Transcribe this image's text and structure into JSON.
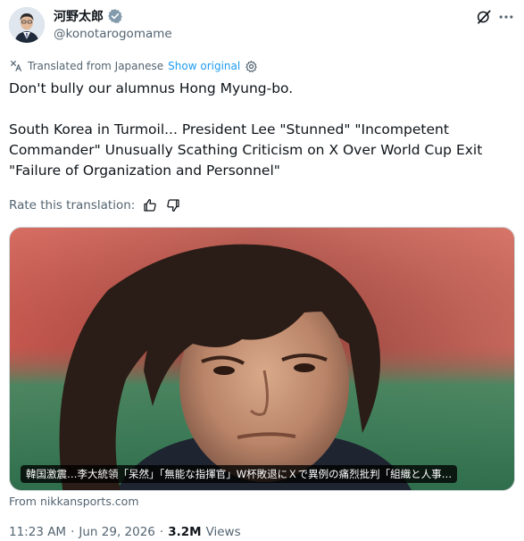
{
  "author": {
    "display_name": "河野太郎",
    "handle": "@konotarogomame",
    "verified_icon": "verified-badge-icon",
    "verified_color": "#829aab"
  },
  "translation": {
    "label": "Translated from Japanese",
    "show_original": "Show original",
    "rate_label": "Rate this translation:"
  },
  "tweet": {
    "line1": "Don't bully our alumnus Hong Myung-bo.",
    "para2_line1": "South Korea in Turmoil... President Lee \"Stunned\" \"Incompetent",
    "para2_line2": "Commander\" Unusually Scathing Criticism on X Over World Cup Exit",
    "para2_line3": "\"Failure of Organization and Personnel\""
  },
  "card": {
    "caption": "韓国激震…李大統領「呆然」「無能な指揮官」W杯敗退にＸで異例の痛烈批判「組織と人事…",
    "source": "From nikkansports.com"
  },
  "meta": {
    "time": "11:23 AM",
    "separator1": "·",
    "date": "Jun 29, 2026",
    "separator2": "·",
    "views_count": "3.2M",
    "views_label": "Views"
  },
  "colors": {
    "text": "#0f1419",
    "secondary": "#536471",
    "link": "#1d9bf0",
    "border": "#cfd9de"
  }
}
